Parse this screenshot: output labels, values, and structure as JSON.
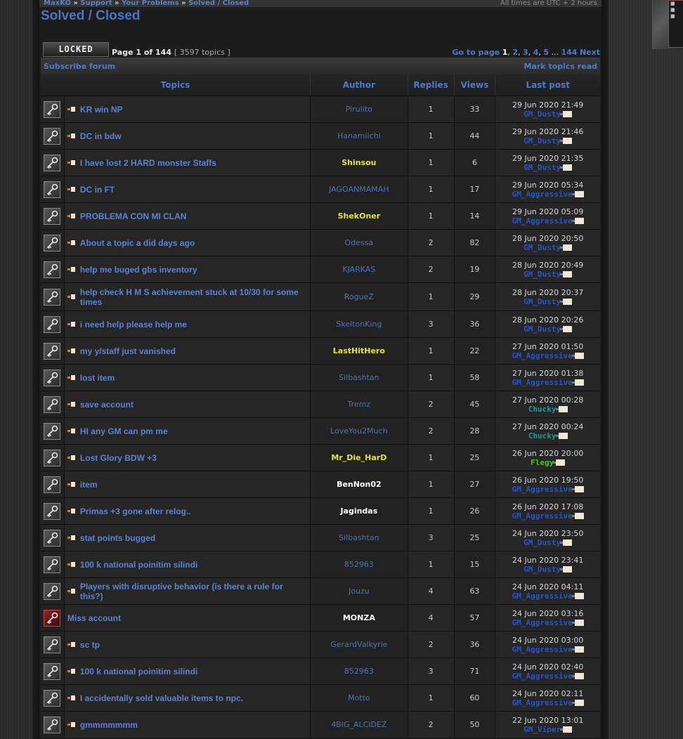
{
  "breadcrumbs": [
    "MaxKO",
    "Support",
    "Your Problems",
    "Solved / Closed"
  ],
  "breadcrumb_sep": "»",
  "timezone": "All times are UTC + 2 hours",
  "forum_title": "Solved / Closed",
  "locked_label": "LOCKED",
  "page_info": "Page 1 of 144",
  "topic_count": "[ 3597 topics ]",
  "pagination": {
    "label": "Go to page",
    "current": "1",
    "pages": [
      "2",
      "3",
      "4",
      "5"
    ],
    "ellipsis": "...",
    "last": "144",
    "next": "Next"
  },
  "subscribe_label": "Subscribe forum",
  "mark_read_label": "Mark topics read",
  "columns": {
    "topics": "Topics",
    "author": "Author",
    "replies": "Replies",
    "views": "Views",
    "last_post": "Last post"
  },
  "colors": {
    "link": "#5a84d4",
    "mod": "#2a54c4",
    "admin_yellow": "#e7e81c",
    "teal": "#1a9c9c",
    "green": "#46c816",
    "white": "#ffffff",
    "user": "#4e74b8"
  },
  "topics": [
    {
      "title": "KR win NP",
      "author": "Pirulito",
      "author_color": "#4e74b8",
      "author_bold": false,
      "replies": "1",
      "views": "33",
      "last_date": "29 Jun 2020 21:49",
      "last_user": "GM_Dusty",
      "last_color": "#2a54c4",
      "unread": true,
      "hot": false
    },
    {
      "title": "DC in bdw",
      "author": "Hanamiichi",
      "author_color": "#4e74b8",
      "author_bold": false,
      "replies": "1",
      "views": "44",
      "last_date": "29 Jun 2020 21:46",
      "last_user": "GM_Dusty",
      "last_color": "#2a54c4",
      "unread": true,
      "hot": false
    },
    {
      "title": "I have lost 2 HARD monster Staffs",
      "author": "Shinsou",
      "author_color": "#e7e81c",
      "author_bold": true,
      "replies": "1",
      "views": "6",
      "last_date": "29 Jun 2020 21:35",
      "last_user": "GM_Dusty",
      "last_color": "#2a54c4",
      "unread": true,
      "hot": false
    },
    {
      "title": "DC in FT",
      "author": "JAGOANMAMAH",
      "author_color": "#4e74b8",
      "author_bold": false,
      "replies": "1",
      "views": "17",
      "last_date": "29 Jun 2020 05:34",
      "last_user": "GM_Aggressive",
      "last_color": "#2a54c4",
      "unread": true,
      "hot": false
    },
    {
      "title": "PROBLEMA CON MI CLAN",
      "author": "ShekOner",
      "author_color": "#e7e81c",
      "author_bold": true,
      "replies": "1",
      "views": "14",
      "last_date": "29 Jun 2020 05:09",
      "last_user": "GM_Aggressive",
      "last_color": "#2a54c4",
      "unread": true,
      "hot": false
    },
    {
      "title": "About a topic a did days ago",
      "author": "Odessa",
      "author_color": "#4e74b8",
      "author_bold": false,
      "replies": "2",
      "views": "82",
      "last_date": "28 Jun 2020 20:50",
      "last_user": "GM_Dusty",
      "last_color": "#2a54c4",
      "unread": true,
      "hot": false
    },
    {
      "title": "help me buged gbs inventory",
      "author": "KJARKAS",
      "author_color": "#4e74b8",
      "author_bold": false,
      "replies": "2",
      "views": "19",
      "last_date": "28 Jun 2020 20:49",
      "last_user": "GM_Dusty",
      "last_color": "#2a54c4",
      "unread": true,
      "hot": false
    },
    {
      "title": "help check H M S achievement stuck at 10/30 for some times",
      "author": "RogueZ",
      "author_color": "#4e74b8",
      "author_bold": false,
      "replies": "1",
      "views": "29",
      "last_date": "28 Jun 2020 20:37",
      "last_user": "GM_Dusty",
      "last_color": "#2a54c4",
      "unread": true,
      "hot": false,
      "tall": true
    },
    {
      "title": "i need help please help me",
      "author": "SkeltonKing",
      "author_color": "#4e74b8",
      "author_bold": false,
      "replies": "3",
      "views": "36",
      "last_date": "28 Jun 2020 20:26",
      "last_user": "GM_Dusty",
      "last_color": "#2a54c4",
      "unread": true,
      "hot": false
    },
    {
      "title": "my y/staff just vanished",
      "author": "LastHitHero",
      "author_color": "#e7e81c",
      "author_bold": true,
      "replies": "1",
      "views": "22",
      "last_date": "27 Jun 2020 01:50",
      "last_user": "GM_Aggressive",
      "last_color": "#2a54c4",
      "unread": true,
      "hot": false
    },
    {
      "title": "lost item",
      "author": "Silbashtan",
      "author_color": "#4e74b8",
      "author_bold": false,
      "replies": "1",
      "views": "58",
      "last_date": "27 Jun 2020 01:38",
      "last_user": "GM_Aggressive",
      "last_color": "#2a54c4",
      "unread": true,
      "hot": false
    },
    {
      "title": "save account",
      "author": "Tremz",
      "author_color": "#4e74b8",
      "author_bold": false,
      "replies": "2",
      "views": "45",
      "last_date": "27 Jun 2020 00:28",
      "last_user": "Chucky",
      "last_color": "#1a9c9c",
      "unread": true,
      "hot": false
    },
    {
      "title": "HI any GM can pm me",
      "author": "LoveYou2Much",
      "author_color": "#4e74b8",
      "author_bold": false,
      "replies": "2",
      "views": "28",
      "last_date": "27 Jun 2020 00:24",
      "last_user": "Chucky",
      "last_color": "#1a9c9c",
      "unread": true,
      "hot": false
    },
    {
      "title": "Lost Glory BDW +3",
      "author": "Mr_Die_HarD",
      "author_color": "#e7e81c",
      "author_bold": true,
      "replies": "1",
      "views": "25",
      "last_date": "26 Jun 2020 20:00",
      "last_user": "Flegy",
      "last_color": "#46c816",
      "unread": true,
      "hot": false
    },
    {
      "title": "item",
      "author": "BenNon02",
      "author_color": "#ffffff",
      "author_bold": true,
      "replies": "1",
      "views": "27",
      "last_date": "26 Jun 2020 19:50",
      "last_user": "GM_Aggressive",
      "last_color": "#2a54c4",
      "unread": true,
      "hot": false
    },
    {
      "title": "Primas +3 gone after relog..",
      "author": "Jagindas",
      "author_color": "#ffffff",
      "author_bold": true,
      "replies": "1",
      "views": "26",
      "last_date": "26 Jun 2020 17:08",
      "last_user": "GM_Aggressive",
      "last_color": "#2a54c4",
      "unread": true,
      "hot": false
    },
    {
      "title": "stat points bugged",
      "author": "Silbashtan",
      "author_color": "#4e74b8",
      "author_bold": false,
      "replies": "3",
      "views": "25",
      "last_date": "24 Jun 2020 23:50",
      "last_user": "GM_Dusty",
      "last_color": "#2a54c4",
      "unread": true,
      "hot": false
    },
    {
      "title": "100 k national poinitim silindi",
      "author": "852963",
      "author_color": "#4e74b8",
      "author_bold": false,
      "replies": "1",
      "views": "15",
      "last_date": "24 Jun 2020 23:41",
      "last_user": "GM_Dusty",
      "last_color": "#2a54c4",
      "unread": true,
      "hot": false
    },
    {
      "title": "Players with disruptive behavior (is there a rule for this?)",
      "author": "Jouzu",
      "author_color": "#4e74b8",
      "author_bold": false,
      "replies": "4",
      "views": "63",
      "last_date": "24 Jun 2020 04:11",
      "last_user": "GM_Aggressive",
      "last_color": "#2a54c4",
      "unread": true,
      "hot": false
    },
    {
      "title": "Miss account",
      "author": "MONZA",
      "author_color": "#ffffff",
      "author_bold": true,
      "replies": "4",
      "views": "57",
      "last_date": "24 Jun 2020 03:16",
      "last_user": "GM_Aggressive",
      "last_color": "#2a54c4",
      "unread": false,
      "hot": true
    },
    {
      "title": "sc tp",
      "author": "GerardValkyrie",
      "author_color": "#4e74b8",
      "author_bold": false,
      "replies": "2",
      "views": "36",
      "last_date": "24 Jun 2020 03:00",
      "last_user": "GM_Aggressive",
      "last_color": "#2a54c4",
      "unread": true,
      "hot": false
    },
    {
      "title": "100 k national poinitim silindi",
      "author": "852963",
      "author_color": "#4e74b8",
      "author_bold": false,
      "replies": "3",
      "views": "71",
      "last_date": "24 Jun 2020 02:40",
      "last_user": "GM_Aggressive",
      "last_color": "#2a54c4",
      "unread": true,
      "hot": false
    },
    {
      "title": "I accidentally sold valuable items to npc.",
      "author": "Motto",
      "author_color": "#4e74b8",
      "author_bold": false,
      "replies": "1",
      "views": "60",
      "last_date": "24 Jun 2020 02:11",
      "last_user": "GM_Aggressive",
      "last_color": "#2a54c4",
      "unread": true,
      "hot": false
    },
    {
      "title": "gmmmmmmm",
      "author": "4BIG_ALCIDEZ",
      "author_color": "#4e74b8",
      "author_bold": false,
      "replies": "2",
      "views": "50",
      "last_date": "22 Jun 2020 13:01",
      "last_user": "GM_Viper",
      "last_color": "#2a54c4",
      "unread": true,
      "hot": false
    }
  ]
}
